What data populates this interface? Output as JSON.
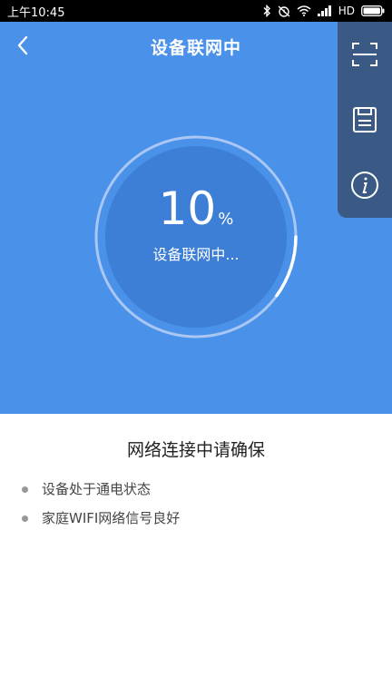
{
  "status_bar": {
    "time": "上午10:45",
    "network": "HD",
    "icons": [
      "bluetooth-icon",
      "alarm-icon",
      "wifi-icon",
      "signal-icon",
      "battery-icon"
    ]
  },
  "header": {
    "title": "设备联网中",
    "back_icon": "chevron-left-icon"
  },
  "actions": [
    {
      "name": "scan",
      "icon": "scan-icon"
    },
    {
      "name": "save",
      "icon": "save-icon"
    },
    {
      "name": "info",
      "icon": "info-icon"
    }
  ],
  "progress": {
    "value": 10,
    "value_text": "10",
    "unit": "%",
    "status_text": "设备联网中..."
  },
  "notice": {
    "title": "网络连接中请确保",
    "items": [
      "设备处于通电状态",
      "家庭WIFI网络信号良好"
    ]
  },
  "colors": {
    "primary": "#4a91ea",
    "circle_fill": "#3d7fd6",
    "panel": "#3a5a85",
    "text_dark": "#222222"
  }
}
